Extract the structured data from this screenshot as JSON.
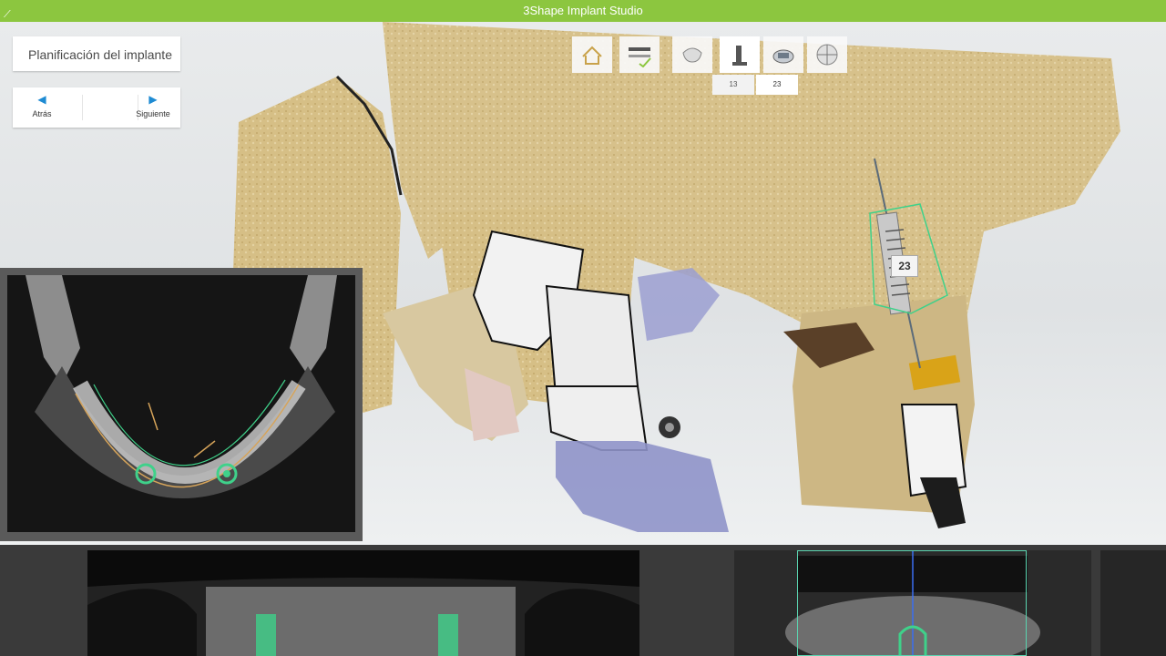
{
  "window": {
    "title": "3Shape Implant Studio"
  },
  "workflow": {
    "step_title": "Planificación del implante"
  },
  "nav": {
    "back_label": "Atrás",
    "next_label": "Siguiente"
  },
  "toolbar": {
    "buttons": [
      "home-icon",
      "checklist-icon",
      "jaw-icon",
      "implant-icon",
      "scan-icon",
      "sphere-icon"
    ],
    "active": "implant-icon"
  },
  "tooth_tabs": [
    "13",
    "23"
  ],
  "implant": {
    "tooth_number": "23"
  },
  "colors": {
    "titlebar": "#8cc63f",
    "accent": "#1e8bd3",
    "bone": "#d9c38a",
    "implant_marker": "#3fd18a"
  }
}
